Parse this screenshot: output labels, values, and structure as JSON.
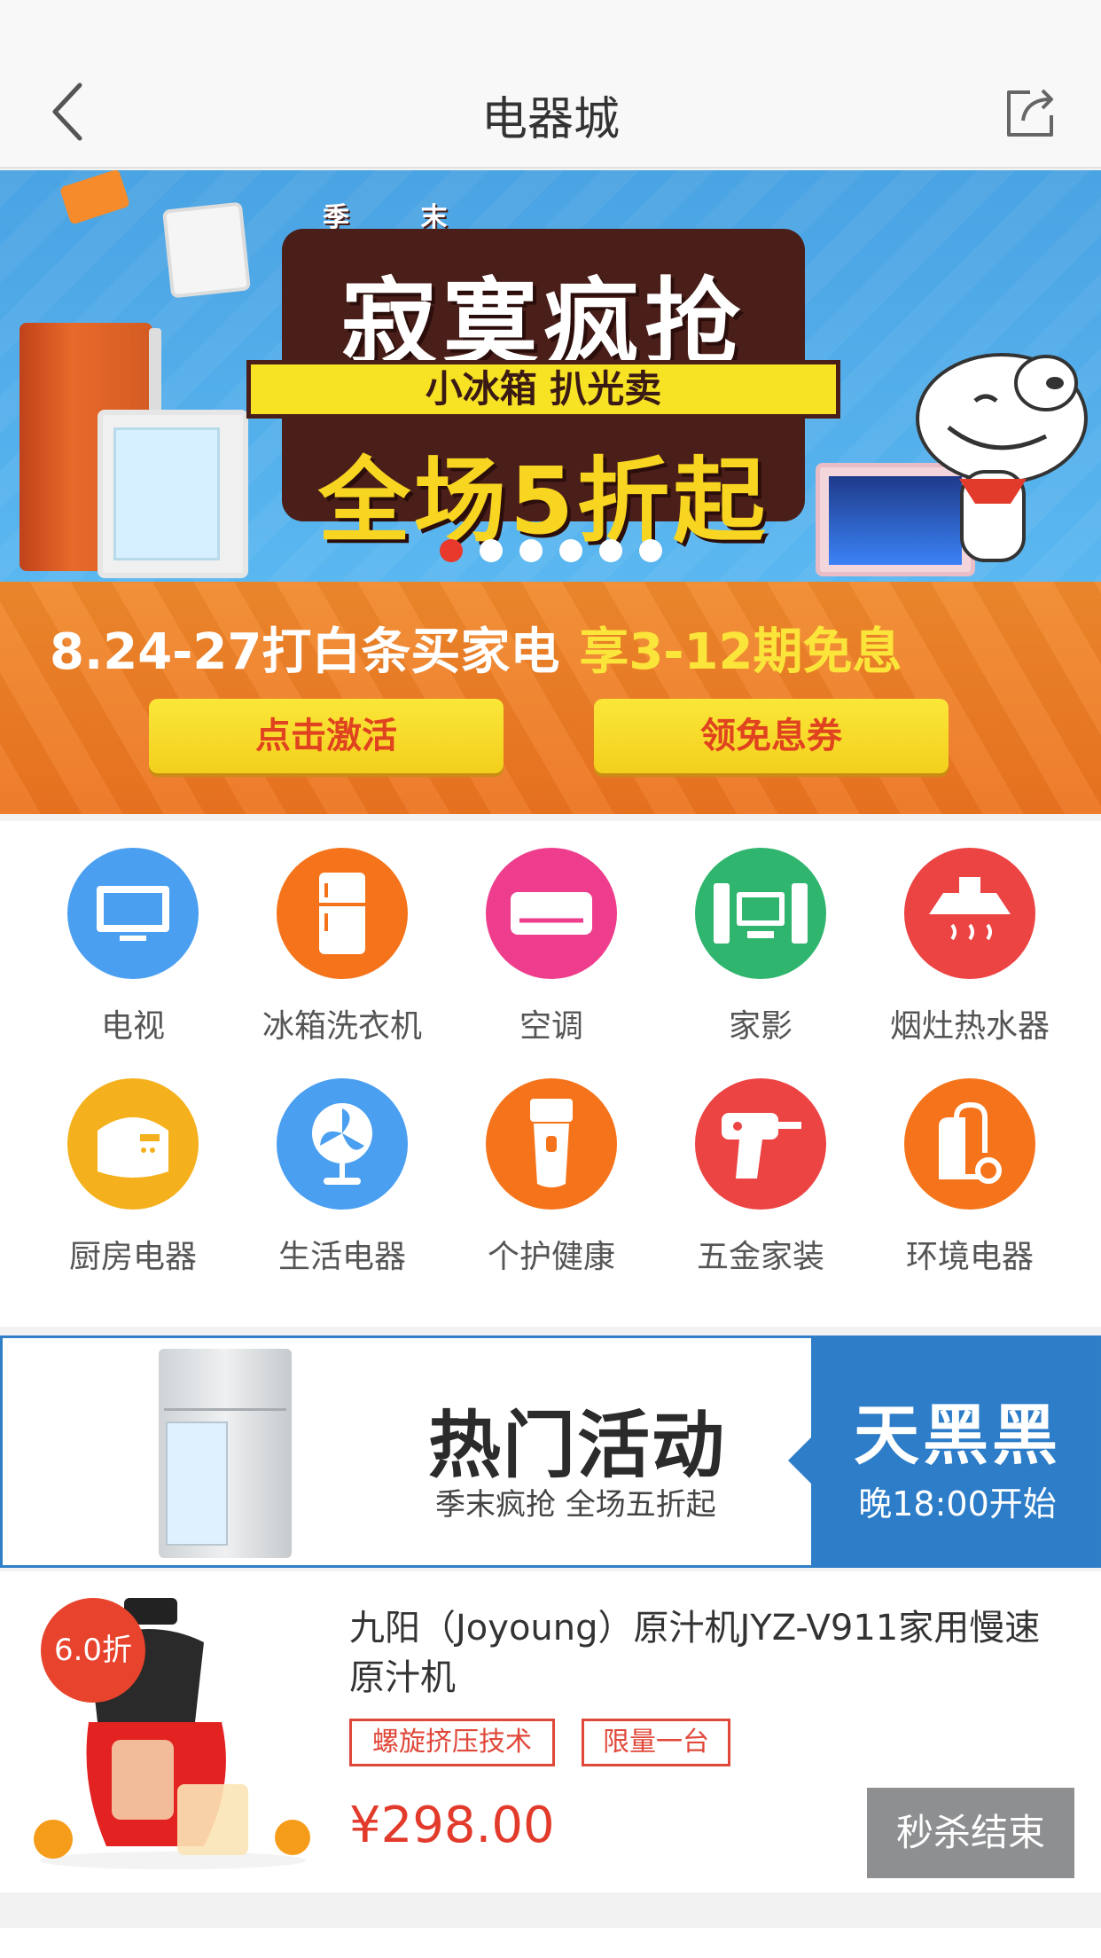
{
  "header": {
    "title": "电器城",
    "back_icon": "chevron-left-icon",
    "share_icon": "share-icon"
  },
  "banner": {
    "small_tags": [
      "季",
      "末"
    ],
    "title": "寂寞疯抢",
    "ribbon": "小冰箱  扒光卖",
    "sale": "全场5折起",
    "slides": 6,
    "active_slide": 1,
    "promo_line": "8.24-27打白条买家电",
    "promo_highlight": "享3-12期免息",
    "btn_activate": "点击激活",
    "btn_coupon": "领免息券"
  },
  "categories": [
    {
      "label": "电视",
      "icon": "tv-icon",
      "color": "#4a9ff0"
    },
    {
      "label": "冰箱洗衣机",
      "icon": "fridge-icon",
      "color": "#f5741b"
    },
    {
      "label": "空调",
      "icon": "air-conditioner-icon",
      "color": "#ee3d8c"
    },
    {
      "label": "家影",
      "icon": "home-theater-icon",
      "color": "#2fb56d"
    },
    {
      "label": "烟灶热水器",
      "icon": "range-hood-icon",
      "color": "#ec4343"
    },
    {
      "label": "厨房电器",
      "icon": "rice-cooker-icon",
      "color": "#f5b11d"
    },
    {
      "label": "生活电器",
      "icon": "fan-icon",
      "color": "#4a9ff0"
    },
    {
      "label": "个护健康",
      "icon": "shaver-icon",
      "color": "#f5741b"
    },
    {
      "label": "五金家装",
      "icon": "drill-icon",
      "color": "#ec4343"
    },
    {
      "label": "环境电器",
      "icon": "vacuum-icon",
      "color": "#f5741b"
    }
  ],
  "hot_activity": {
    "title": "热门活动",
    "subtitle": "季末疯抢 全场五折起",
    "right_title": "天黑黑",
    "right_subtitle": "晚18:00开始"
  },
  "product": {
    "discount": "6.0折",
    "name": "九阳（Joyoung）原汁机JYZ-V911家用慢速原汁机",
    "tags": [
      "螺旋挤压技术",
      "限量一台"
    ],
    "price": "¥298.00",
    "button": "秒杀结束"
  },
  "colors": {
    "accent_red": "#e23a2b",
    "hot_blue": "#2d7dc8",
    "promo_orange": "#ec7420"
  }
}
